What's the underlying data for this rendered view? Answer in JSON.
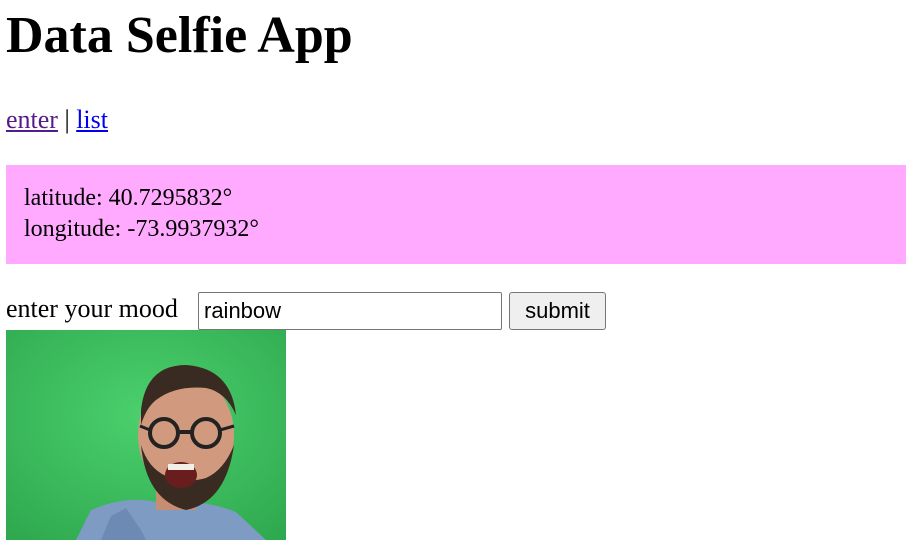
{
  "page": {
    "title": "Data Selfie App"
  },
  "nav": {
    "enter_label": "enter",
    "separator": "|",
    "list_label": "list"
  },
  "geo": {
    "latitude_label": "latitude:",
    "latitude_value": "40.7295832",
    "longitude_label": "longitude:",
    "longitude_value": "-73.9937932",
    "degree_symbol": "°"
  },
  "mood": {
    "label": "enter your mood",
    "value": "rainbow",
    "submit_label": "submit"
  },
  "colors": {
    "geo_background": "#ffaaff",
    "visited_link": "#551a8b",
    "link": "#0000ee",
    "video_background": "#3ec060"
  }
}
